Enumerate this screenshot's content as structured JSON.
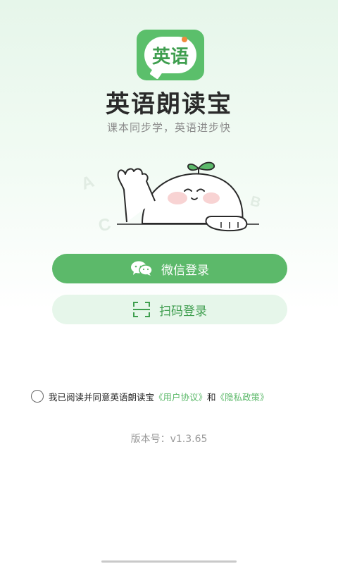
{
  "app": {
    "logo_text": "英语",
    "title": "英语朗读宝",
    "slogan": "课本同步学，英语进步快"
  },
  "illustration": {
    "letters": [
      "A",
      "B",
      "C"
    ]
  },
  "buttons": {
    "wechat_login": "微信登录",
    "scan_login": "扫码登录"
  },
  "agreement": {
    "prefix": "我已阅读并同意英语朗读宝",
    "user_agreement": "《用户协议》",
    "conjunction": "和",
    "privacy_policy": "《隐私政策》",
    "checked": false
  },
  "version": {
    "text": "版本号：v1.3.65"
  },
  "colors": {
    "accent": "#5cb96a",
    "accent_light": "#e6f6ea"
  }
}
